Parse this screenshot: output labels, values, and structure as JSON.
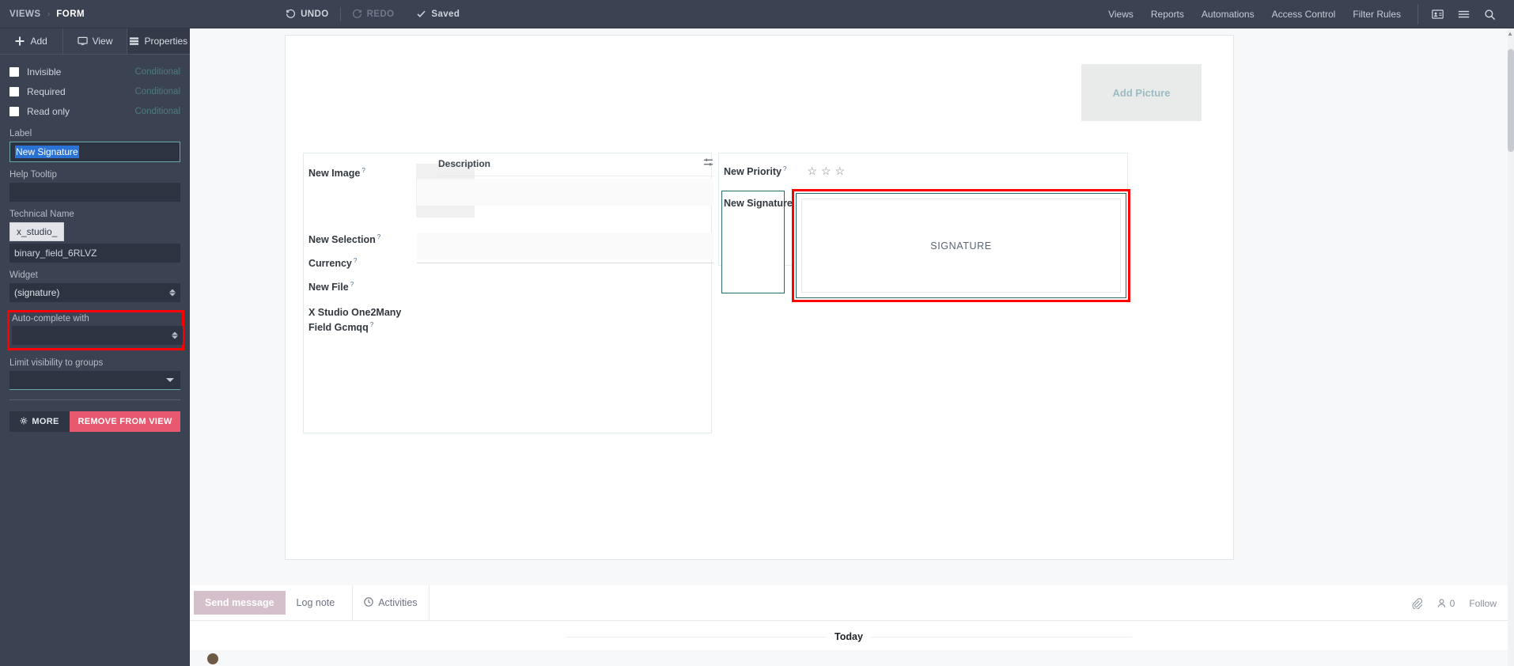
{
  "topbar": {
    "breadcrumb": [
      "VIEWS",
      "FORM"
    ],
    "undo": "UNDO",
    "redo": "REDO",
    "saved": "Saved",
    "nav": [
      "Views",
      "Reports",
      "Automations",
      "Access Control",
      "Filter Rules"
    ],
    "icons": [
      "contact-card-icon",
      "list-icon",
      "search-icon"
    ]
  },
  "sidebar": {
    "tabs": [
      {
        "label": "Add",
        "icon": "plus-icon",
        "active": false
      },
      {
        "label": "View",
        "icon": "monitor-icon",
        "active": false
      },
      {
        "label": "Properties",
        "icon": "properties-icon",
        "active": true
      }
    ],
    "checkboxes": [
      {
        "label": "Invisible",
        "link": "Conditional",
        "checked": false
      },
      {
        "label": "Required",
        "link": "Conditional",
        "checked": false
      },
      {
        "label": "Read only",
        "link": "Conditional",
        "checked": false
      }
    ],
    "label_field": {
      "label": "Label",
      "value": "New Signature"
    },
    "tooltip_field": {
      "label": "Help Tooltip",
      "value": ""
    },
    "technical_name": {
      "label": "Technical Name",
      "prefix": "x_studio_",
      "value": "binary_field_6RLVZ"
    },
    "widget": {
      "label": "Widget",
      "value": "(signature)"
    },
    "autocomplete": {
      "label": "Auto-complete with",
      "value": ""
    },
    "limit_groups": {
      "label": "Limit visibility to groups",
      "value": ""
    },
    "more_button": "MORE",
    "remove_button": "REMOVE FROM VIEW"
  },
  "form": {
    "add_picture": "Add Picture",
    "left_fields": [
      {
        "label": "New Image",
        "help": "?"
      },
      {
        "label": "New Selection",
        "help": "?"
      },
      {
        "label": "Currency",
        "help": "?"
      },
      {
        "label": "New File",
        "help": "?"
      }
    ],
    "o2m": {
      "label_line1": "X Studio One2Many",
      "label_line2": "Field Gcmqq",
      "help": "?",
      "columns": [
        "Description"
      ],
      "rows": [],
      "settings_icon": "adjust-settings-icon"
    },
    "priority": {
      "label": "New Priority",
      "help": "?",
      "stars": 3,
      "filled": 0
    },
    "signature": {
      "label": "New Signature",
      "help": "?",
      "placeholder": "SIGNATURE"
    }
  },
  "chatter": {
    "tabs": [
      {
        "label": "Send message",
        "active": true
      },
      {
        "label": "Log note",
        "active": false
      },
      {
        "label": "Activities",
        "active": false,
        "icon": "clock-icon"
      }
    ],
    "attachment_icon": "paperclip-icon",
    "followers_icon": "person-icon",
    "followers_count": "0",
    "follow_label": "Follow",
    "date_separator": "Today"
  },
  "colors": {
    "dark_panel": "#3b4252",
    "accent_teal": "#4e7b7e",
    "highlight_red": "#ff0000",
    "selection_blue": "#2a72d4",
    "remove_pink": "#e8596f",
    "chatter_active": "#d4bfcb"
  }
}
